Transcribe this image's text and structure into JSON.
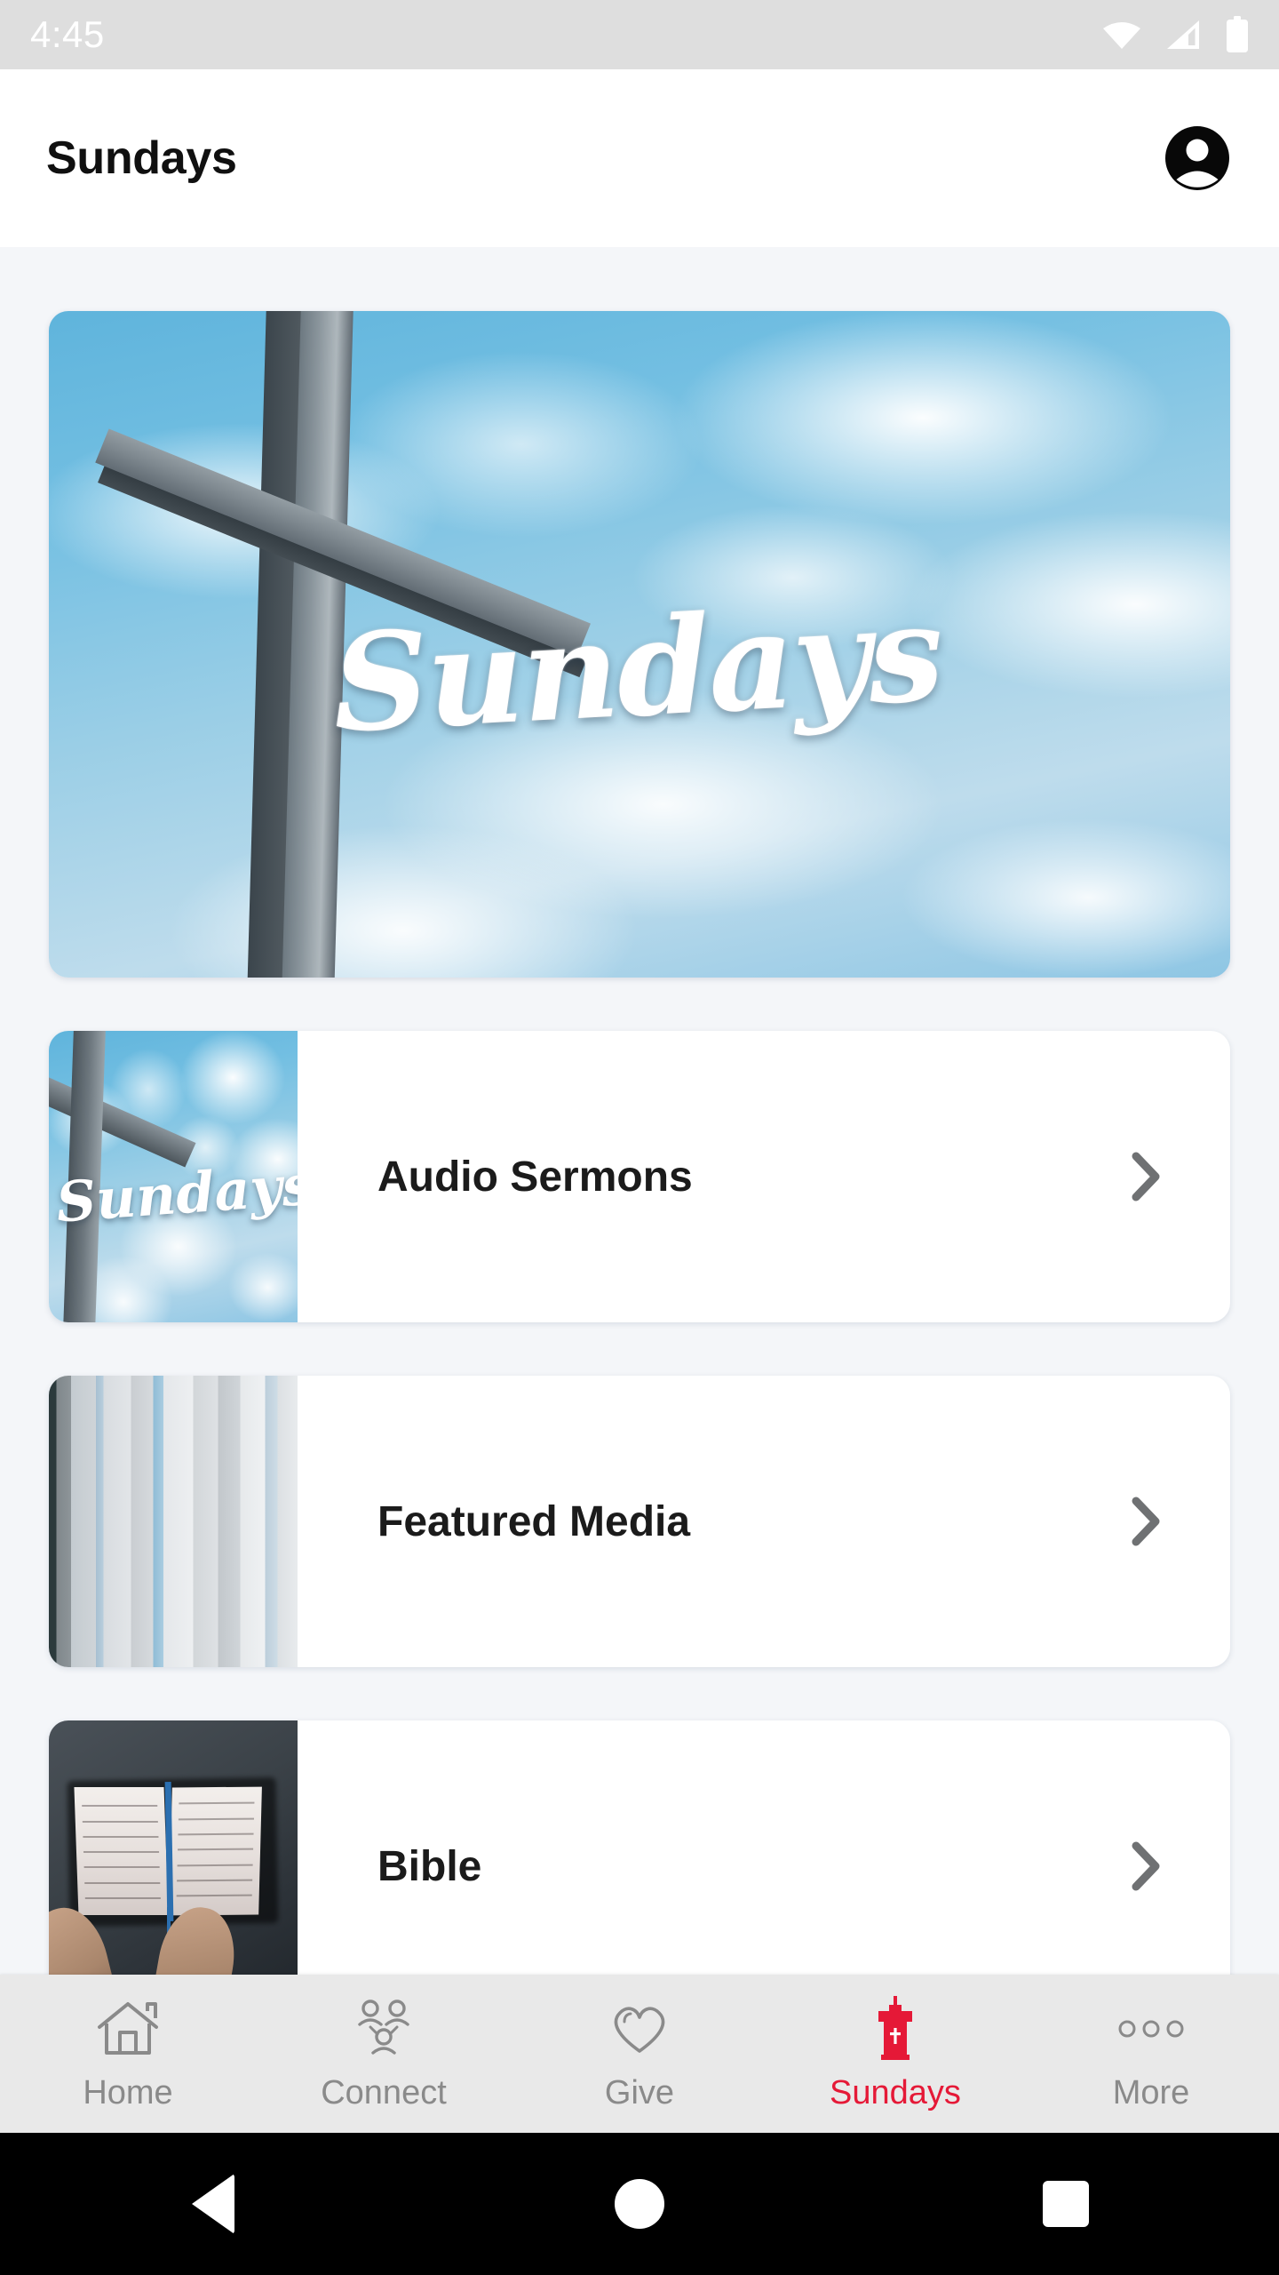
{
  "status_bar": {
    "time": "4:45",
    "icons": [
      "wifi-icon",
      "cellular-signal-icon",
      "battery-icon"
    ],
    "background_color": "#DEDEDE",
    "text_color": "#FFFFFF"
  },
  "app_bar": {
    "title": "Sundays",
    "account_icon": "account-avatar-icon",
    "background_color": "#FFFFFF"
  },
  "hero": {
    "overlay_text": "Sundays",
    "image_description": "wooden-cross-against-cloudy-blue-sky"
  },
  "list": {
    "items": [
      {
        "label": "Audio Sermons",
        "thumbnail": "sundays-cross-sky-thumbnail",
        "chevron": "chevron-right-icon"
      },
      {
        "label": "Featured Media",
        "thumbnail": "motion-blur-stripes-thumbnail",
        "chevron": "chevron-right-icon"
      },
      {
        "label": "Bible",
        "thumbnail": "hands-holding-open-bible-thumbnail",
        "chevron": "chevron-right-icon"
      }
    ]
  },
  "tab_bar": {
    "active_color": "#E51937",
    "inactive_color": "#8A8A8A",
    "background_color": "#E9E9E9",
    "tabs": [
      {
        "label": "Home",
        "icon": "home-icon",
        "active": false
      },
      {
        "label": "Connect",
        "icon": "people-group-icon",
        "active": false
      },
      {
        "label": "Give",
        "icon": "heart-icon",
        "active": false
      },
      {
        "label": "Sundays",
        "icon": "pulpit-cross-icon",
        "active": true
      },
      {
        "label": "More",
        "icon": "more-dots-icon",
        "active": false
      }
    ]
  },
  "system_nav": {
    "back": "back-triangle-icon",
    "home": "home-circle-icon",
    "recents": "recents-square-icon"
  },
  "theme": {
    "page_background": "#F4F6F9",
    "card_background": "#FFFFFF",
    "accent_red": "#E51937",
    "text_primary": "#1B1B1B",
    "chevron_gray": "#6F7173"
  }
}
